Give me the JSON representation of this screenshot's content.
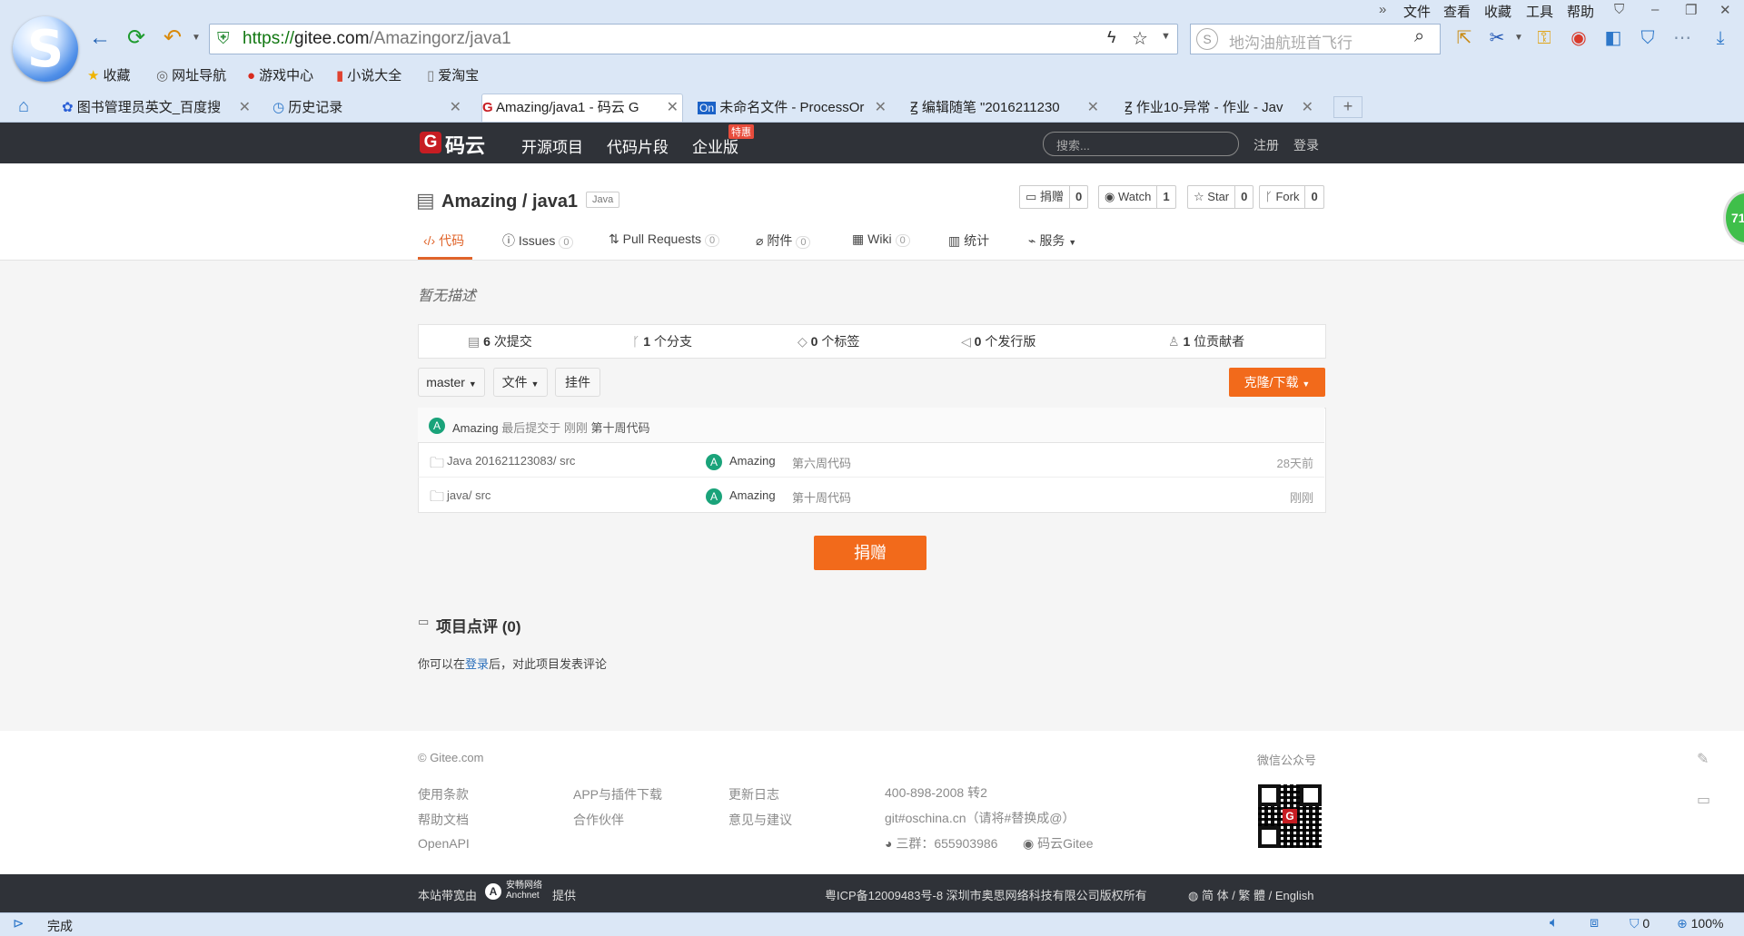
{
  "browser": {
    "menu": [
      "文件",
      "查看",
      "收藏",
      "工具",
      "帮助"
    ],
    "url_prefix": "https://",
    "url_host": "gitee.com",
    "url_path": "/Amazingorz/java1",
    "search_placeholder": "地沟油航班首飞行",
    "bookmarks": [
      "收藏",
      "网址导航",
      "游戏中心",
      "小说大全",
      "爱淘宝"
    ],
    "tabs": [
      {
        "label": "图书管理员英文_百度搜"
      },
      {
        "label": "历史记录"
      },
      {
        "label": "Amazing/java1 - 码云 G"
      },
      {
        "label": "未命名文件 - ProcessOr"
      },
      {
        "label": "编辑随笔 \"2016211230"
      },
      {
        "label": "作业10-异常 - 作业 - Jav"
      }
    ],
    "new_tab": "+",
    "status_text": "完成",
    "status_zero": "0",
    "zoom": "100%",
    "side_badge": "71"
  },
  "gitee": {
    "logo": "码云",
    "nav": [
      "开源项目",
      "代码片段",
      "企业版"
    ],
    "promo_badge": "特惠",
    "search_placeholder": "搜索...",
    "register": "注册",
    "login": "登录"
  },
  "repo": {
    "title": "Amazing / java1",
    "lang": "Java",
    "donate_label": "捐赠",
    "donate_count": "0",
    "watch_label": "Watch",
    "watch_count": "1",
    "star_label": "Star",
    "star_count": "0",
    "fork_label": "Fork",
    "fork_count": "0",
    "tabs": [
      {
        "label": "代码",
        "count": ""
      },
      {
        "label": "Issues",
        "count": "0"
      },
      {
        "label": "Pull Requests",
        "count": "0"
      },
      {
        "label": "附件",
        "count": "0"
      },
      {
        "label": "Wiki",
        "count": "0"
      },
      {
        "label": "统计",
        "count": ""
      },
      {
        "label": "服务",
        "count": ""
      }
    ],
    "description": "暂无描述",
    "stats": [
      {
        "num": "6",
        "label": "次提交"
      },
      {
        "num": "1",
        "label": "个分支"
      },
      {
        "num": "0",
        "label": "个标签"
      },
      {
        "num": "0",
        "label": "个发行版"
      },
      {
        "num": "1",
        "label": "位贡献者"
      }
    ],
    "branch": "master",
    "file_menu": "文件",
    "plugin": "挂件",
    "clone": "克隆/下载",
    "last_commit": {
      "author": "Amazing",
      "text": "最后提交于",
      "time": "刚刚",
      "message": "第十周代码"
    },
    "files": [
      {
        "name": "Java 201621123083/ src",
        "author": "Amazing",
        "message": "第六周代码",
        "time": "28天前"
      },
      {
        "name": "java/ src",
        "author": "Amazing",
        "message": "第十周代码",
        "time": "刚刚"
      }
    ],
    "donate_big": "捐赠",
    "comments_title": "项目点评 (0)",
    "comment_prefix": "你可以在",
    "comment_login": "登录",
    "comment_suffix": "后，对此项目发表评论"
  },
  "footer": {
    "copyright": "© Gitee.com",
    "links_col1": [
      "使用条款",
      "帮助文档",
      "OpenAPI"
    ],
    "links_col2": [
      "APP与插件下载",
      "合作伙伴"
    ],
    "links_col3": [
      "更新日志",
      "意见与建议"
    ],
    "phone": "400-898-2008 转2",
    "email": "git#oschina.cn（请将#替换成@）",
    "qq": "三群：655903986",
    "weibo": "码云Gitee",
    "wechat": "微信公众号",
    "bandwidth": "本站带宽由",
    "anchnet": "安畅网络",
    "anchnet_en": "Anchnet",
    "provided": "提供",
    "icp": "粤ICP备12009483号-8 深圳市奥思网络科技有限公司版权所有",
    "lang": "简 体 / 繁 體 / English"
  }
}
